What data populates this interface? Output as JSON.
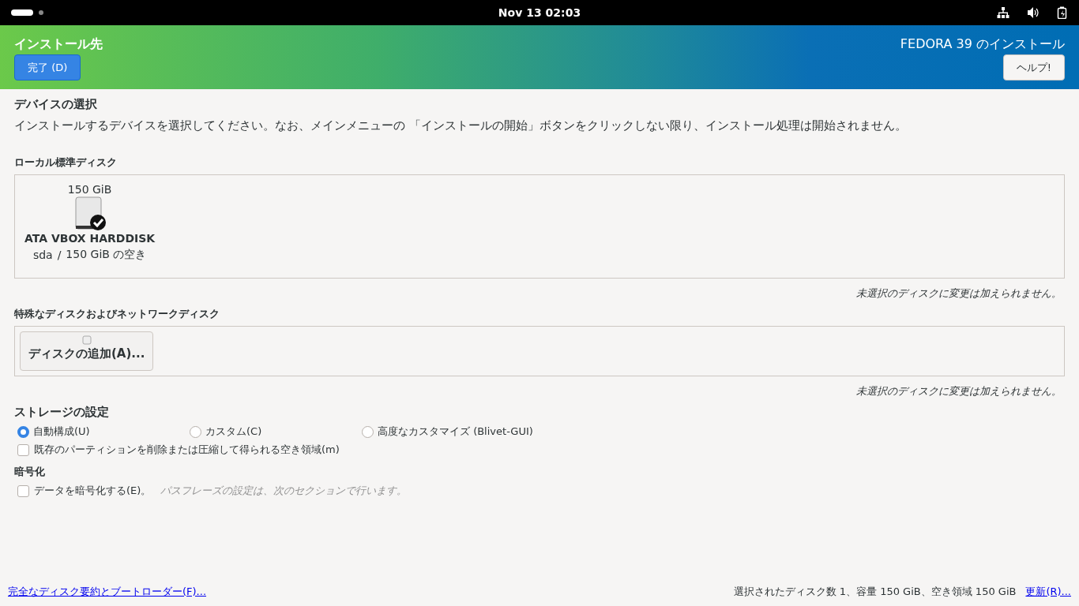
{
  "top_bar": {
    "clock": "Nov 13  02:03"
  },
  "header": {
    "title": "インストール先",
    "done_button": "完了 (D)",
    "product": "FEDORA 39 のインストール",
    "help_button": "ヘルプ!"
  },
  "device_selection": {
    "heading": "デバイスの選択",
    "description": "インストールするデバイスを選択してください。なお、メインメニューの 「インストールの開始」ボタンをクリックしない限り、インストール処理は開始されません。"
  },
  "local_disks": {
    "heading": "ローカル標準ディスク",
    "disks": [
      {
        "size": "150 GiB",
        "name": "ATA VBOX HARDDISK",
        "device": "sda",
        "separator": "/",
        "free": "150 GiB の空き",
        "selected": true
      }
    ],
    "note": "未選択のディスクに変更は加えられません。"
  },
  "special_disks": {
    "heading": "特殊なディスクおよびネットワークディスク",
    "add_button": "ディスクの追加(A)...",
    "note": "未選択のディスクに変更は加えられません。"
  },
  "storage": {
    "heading": "ストレージの設定",
    "options": [
      {
        "label": "自動構成(U)",
        "selected": true
      },
      {
        "label": "カスタム(C)",
        "selected": false
      },
      {
        "label": "高度なカスタマイズ (Blivet-GUI)",
        "selected": false
      }
    ],
    "reclaim": {
      "label": "既存のパーティションを削除または圧縮して得られる空き領域(m)",
      "checked": false
    }
  },
  "encryption": {
    "heading": "暗号化",
    "encrypt": {
      "label": "データを暗号化する(E)。",
      "checked": false
    },
    "hint": "パスフレーズの設定は、次のセクションで行います。"
  },
  "footer": {
    "summary_link": "完全なディスク要約とブートローダー(F)...",
    "status": "選択されたディスク数 1、容量 150 GiB、空き領域 150 GiB",
    "refresh_link": "更新(R)..."
  }
}
